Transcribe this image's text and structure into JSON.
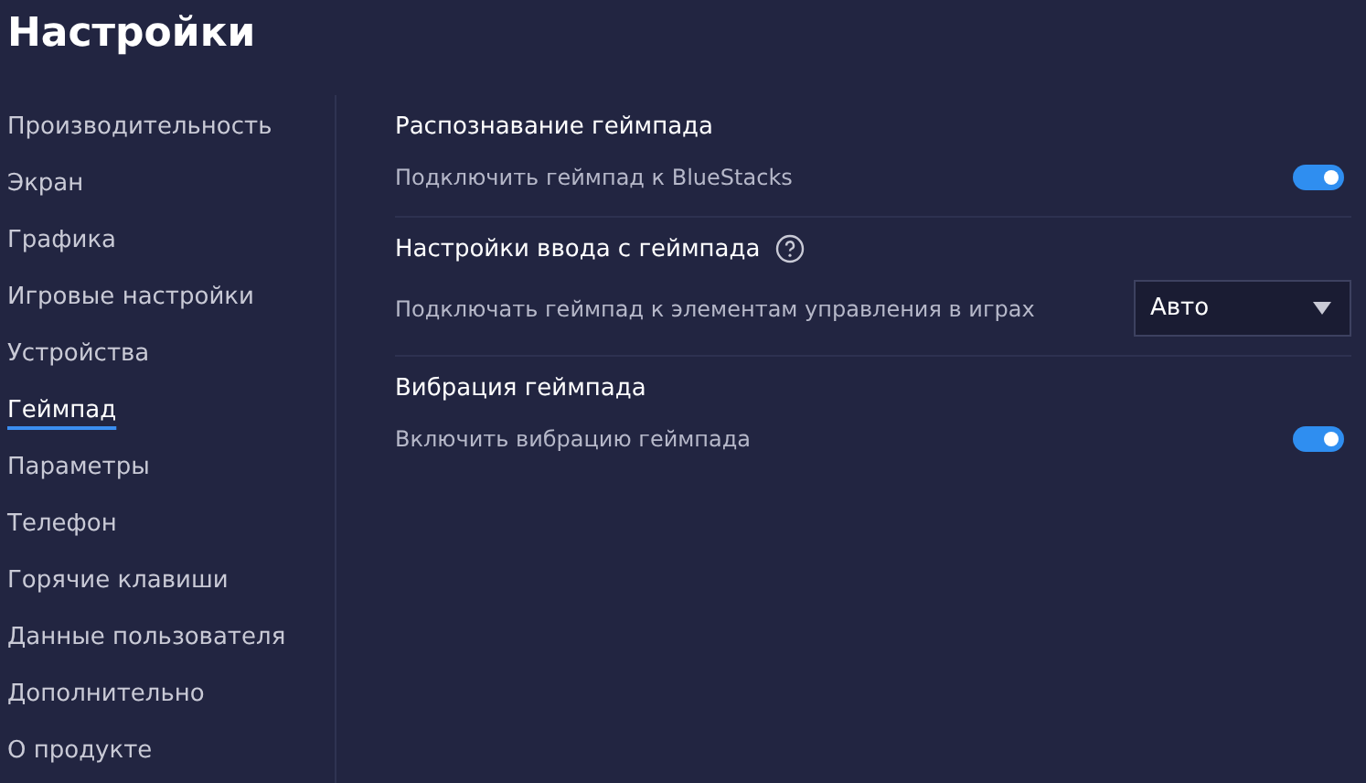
{
  "title": "Настройки",
  "sidebar": {
    "items": [
      {
        "label": "Производительность",
        "selected": false
      },
      {
        "label": "Экран",
        "selected": false
      },
      {
        "label": "Графика",
        "selected": false
      },
      {
        "label": "Игровые настройки",
        "selected": false
      },
      {
        "label": "Устройства",
        "selected": false
      },
      {
        "label": "Геймпад",
        "selected": true
      },
      {
        "label": "Параметры",
        "selected": false
      },
      {
        "label": "Телефон",
        "selected": false
      },
      {
        "label": "Горячие клавиши",
        "selected": false
      },
      {
        "label": "Данные пользователя",
        "selected": false
      },
      {
        "label": "Дополнительно",
        "selected": false
      },
      {
        "label": "О продукте",
        "selected": false
      }
    ]
  },
  "sections": [
    {
      "title": "Распознавание геймпада",
      "help": false,
      "kind": "toggle",
      "label": "Подключить геймпад к BlueStacks",
      "on": true
    },
    {
      "title": "Настройки ввода с геймпада",
      "help": true,
      "kind": "select",
      "label": "Подключать геймпад к элементам управления в играх",
      "value": "Авто"
    },
    {
      "title": "Вибрация геймпада",
      "help": false,
      "kind": "toggle",
      "label": "Включить вибрацию геймпада",
      "on": true
    }
  ]
}
